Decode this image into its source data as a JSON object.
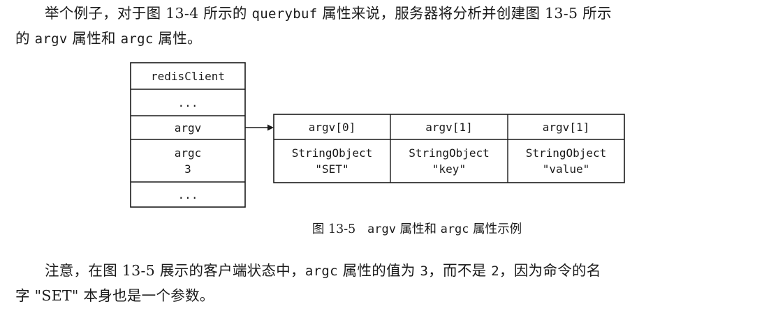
{
  "paragraph1": {
    "line1_pre": "举个例子，对于图 13-4 所示的 ",
    "line1_code": "querybuf",
    "line1_post": " 属性来说，服务器将分析并创建图 13-5 所示",
    "line2_pre": "的 ",
    "line2_code1": "argv",
    "line2_mid": " 属性和 ",
    "line2_code2": "argc",
    "line2_post": " 属性。"
  },
  "diagram": {
    "client": {
      "title": "redisClient",
      "ellipsis_top": "...",
      "argv": "argv",
      "argc_label": "argc",
      "argc_value": "3",
      "ellipsis_bottom": "..."
    },
    "argv_array": [
      {
        "header": "argv[0]",
        "type": "StringObject",
        "value": "\"SET\""
      },
      {
        "header": "argv[1]",
        "type": "StringObject",
        "value": "\"key\""
      },
      {
        "header": "argv[1]",
        "type": "StringObject",
        "value": "\"value\""
      }
    ]
  },
  "caption": {
    "prefix": "图 13-5",
    "code1": "argv",
    "mid": " 属性和 ",
    "code2": "argc",
    "suffix": " 属性示例"
  },
  "paragraph2": {
    "line1_pre": "注意，在图 13-5 展示的客户端状态中，",
    "line1_code": "argc",
    "line1_mid": " 属性的值为 ",
    "line1_num1": "3",
    "line1_mid2": "，而不是 ",
    "line1_num2": "2",
    "line1_post": "，因为命令的名",
    "line2": "字 \"SET\" 本身也是一个参数。"
  }
}
